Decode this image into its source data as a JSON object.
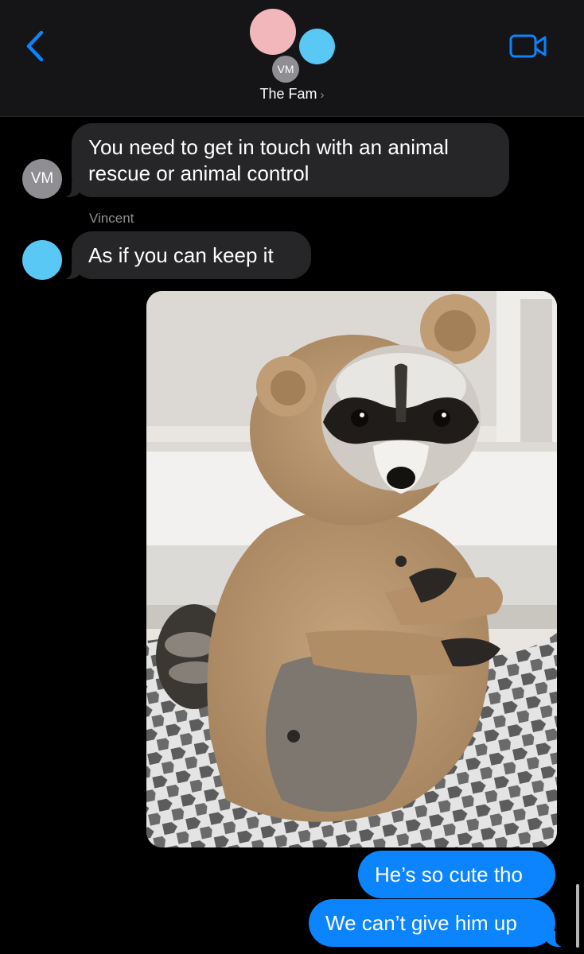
{
  "header": {
    "back_icon": "chevron-left-icon",
    "video_icon": "video-camera-icon",
    "group_avatar_initials": "VM",
    "title": "The Fam",
    "title_chevron": "›",
    "colors": {
      "accent": "#0b84fe",
      "avatar_pink": "#f2b7bb",
      "avatar_blue": "#5ac8f5",
      "avatar_gray": "#8e8e93"
    }
  },
  "messages": [
    {
      "direction": "incoming",
      "avatar": "VM",
      "text": "You need to get in touch with an animal rescue or animal control"
    },
    {
      "direction": "incoming",
      "sender": "Vincent",
      "text": "As if you can keep it"
    },
    {
      "direction": "outgoing",
      "type": "photo"
    },
    {
      "direction": "outgoing",
      "text": "He’s so cute tho"
    },
    {
      "direction": "outgoing",
      "text": "We can’t give him up"
    }
  ]
}
